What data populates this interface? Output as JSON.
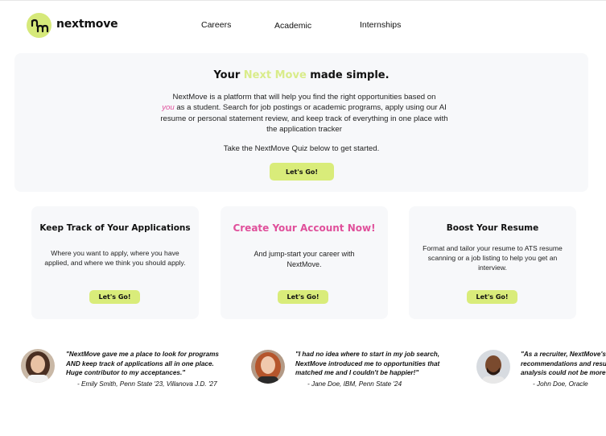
{
  "header": {
    "brand": "nextmove",
    "logo_text": "nm",
    "nav": [
      "Careers",
      "Academic",
      "Internships"
    ]
  },
  "hero": {
    "title_pre": "Your ",
    "title_accent": "Next Move",
    "title_post": " made simple.",
    "desc_1": "NextMove is a platform that will help you find the right opportunities based on",
    "desc_you": "you",
    "desc_2": " as a student. Search for job postings or academic programs, apply using our AI resume or personal statement review, and keep track of everything in one place with the application tracker",
    "quiz_text": "Take the NextMove Quiz below to get started.",
    "button": "Let's Go!"
  },
  "cards": [
    {
      "title": "Keep Track of Your Applications",
      "text": "Where you want to apply, where you have applied, and where we think you should apply.",
      "button": "Let's Go!"
    },
    {
      "title": "Create Your Account Now!",
      "text": "And jump-start your career with NextMove.",
      "button": "Let's Go!"
    },
    {
      "title": "Boost Your Resume",
      "text": "Format and tailor your resume to ATS resume scanning or a job listing to help you get an interview.",
      "button": "Let's Go!"
    }
  ],
  "testimonials": [
    {
      "lines": [
        "\"NextMove gave me a place to look for programs",
        "AND keep track of applications all in one place.",
        "Huge contributor to my acceptances.\""
      ],
      "author": "- Emily Smith, Penn State '23, Villanova J.D. '27"
    },
    {
      "lines": [
        "\"I had no idea where to start in my job search,",
        "NextMove introduced me to opportunities that",
        "matched me and I couldn't be happier!\""
      ],
      "author": "- Jane Doe, IBM, Penn State '24"
    },
    {
      "lines": [
        "\"As a recruiter, NextMove's",
        "recommendations and resu",
        "analysis could not be more"
      ],
      "author": "- John Doe, Oracle"
    }
  ],
  "colors": {
    "accent_green": "#d9ec7a",
    "accent_pink": "#e0509b",
    "panel_bg": "#f7f8fa"
  }
}
